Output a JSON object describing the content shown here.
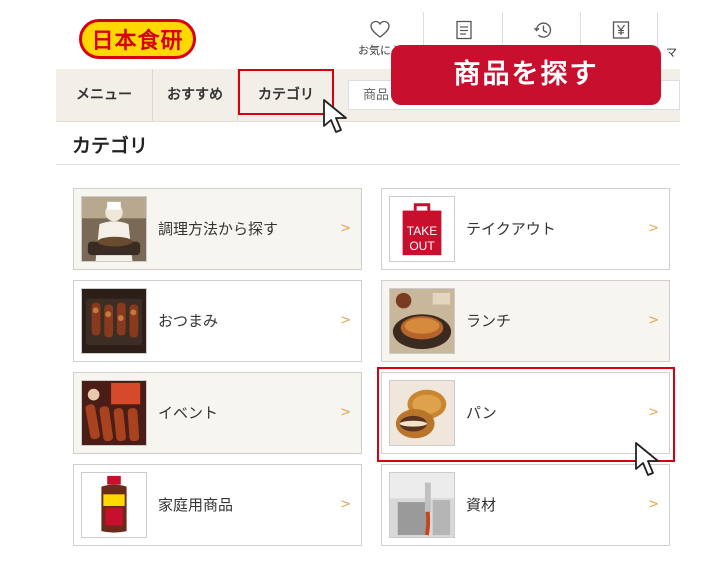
{
  "header": {
    "logo_text": "日本食研",
    "icons": [
      {
        "name": "heart-icon",
        "label": "お気に入"
      },
      {
        "name": "notebook-icon",
        "label": ""
      },
      {
        "name": "history-icon",
        "label": ""
      },
      {
        "name": "yen-icon",
        "label": ""
      },
      {
        "name": "mypage-icon",
        "label": "マ"
      }
    ]
  },
  "tabs": {
    "menu": "メニュー",
    "recommended": "おすすめ",
    "category": "カテゴリ"
  },
  "search": {
    "placeholder": "商品"
  },
  "callout": "商品を探す",
  "section_title": "カテゴリ",
  "categories": [
    {
      "label": "調理方法から探す",
      "arrow": ">"
    },
    {
      "label": "テイクアウト",
      "arrow": ">",
      "thumb_text": [
        "TAKE",
        "OUT"
      ]
    },
    {
      "label": "おつまみ",
      "arrow": ">"
    },
    {
      "label": "ランチ",
      "arrow": ">"
    },
    {
      "label": "イベント",
      "arrow": ">"
    },
    {
      "label": "パン",
      "arrow": ">"
    },
    {
      "label": "家庭用商品",
      "arrow": ">"
    },
    {
      "label": "資材",
      "arrow": ">"
    }
  ],
  "colors": {
    "brand_red": "#d7000f",
    "brand_yellow": "#ffd800",
    "callout_red": "#c8102e",
    "tab_bg": "#f2efe8",
    "arrow_orange": "#e3a44a"
  }
}
